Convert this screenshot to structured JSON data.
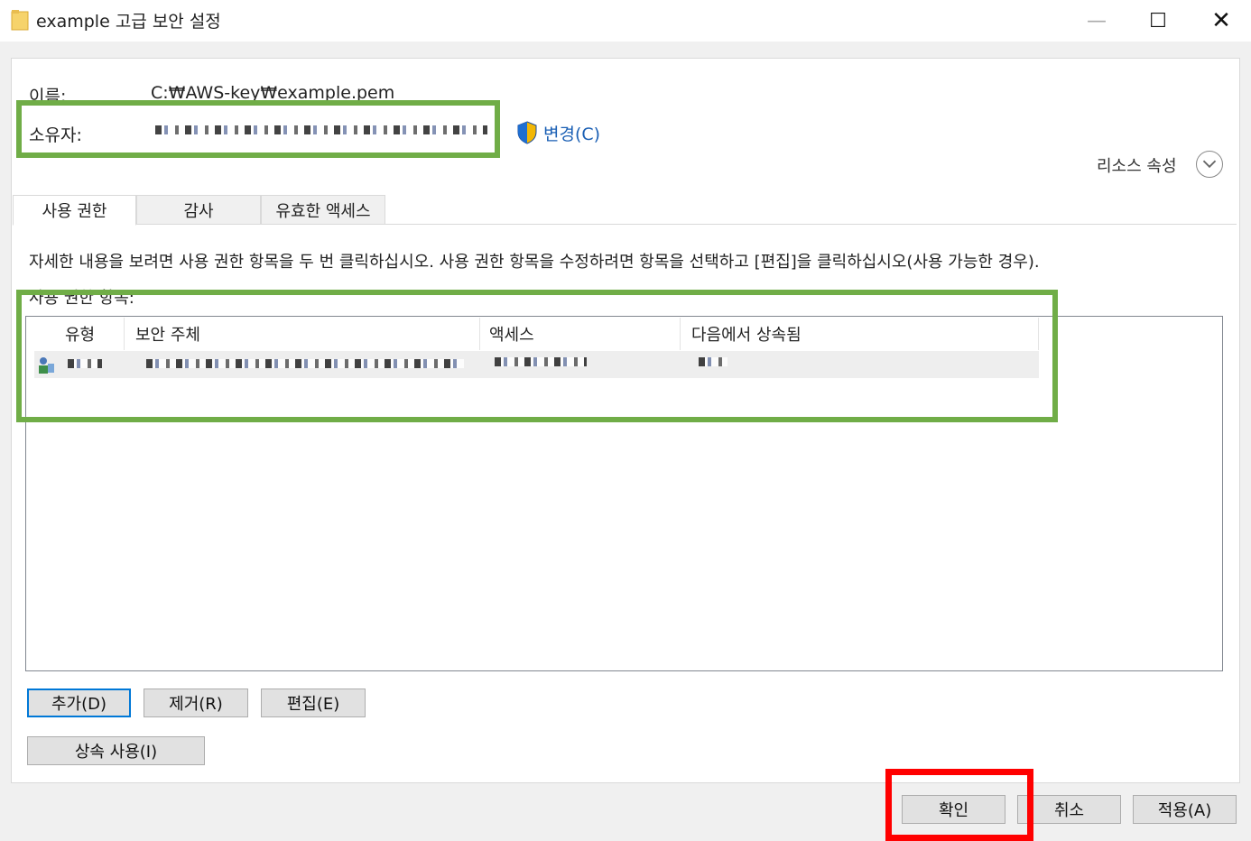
{
  "window": {
    "title": "example 고급 보안 설정",
    "minimize_icon": "—",
    "maximize_icon": "☐",
    "close_icon": "✕"
  },
  "info": {
    "name_label": "이름:",
    "name_value": "C:₩AWS-key₩example.pem",
    "owner_label": "소유자:",
    "change_link": "변경(C)",
    "resource_properties": "리소스 속성"
  },
  "tabs": [
    "사용 권한",
    "감사",
    "유효한 액세스"
  ],
  "description": "자세한 내용을 보려면 사용 권한 항목을 두 번 클릭하십시오. 사용 권한 항목을 수정하려면 항목을 선택하고 [편집]을 클릭하십시오(사용 가능한 경우).",
  "list": {
    "caption": "사용 권한 항목:",
    "columns": [
      "유형",
      "보안 주체",
      "액세스",
      "다음에서 상속됨"
    ]
  },
  "buttons": {
    "add": "추가(D)",
    "remove": "제거(R)",
    "edit": "편집(E)",
    "inheritance": "상속 사용(I)"
  },
  "footer": {
    "ok": "확인",
    "cancel": "취소",
    "apply": "적용(A)"
  },
  "colors": {
    "highlight_green": "#70ad47",
    "highlight_red": "#ff0000",
    "link_blue": "#1a5fb4",
    "accent": "#0078d7"
  }
}
